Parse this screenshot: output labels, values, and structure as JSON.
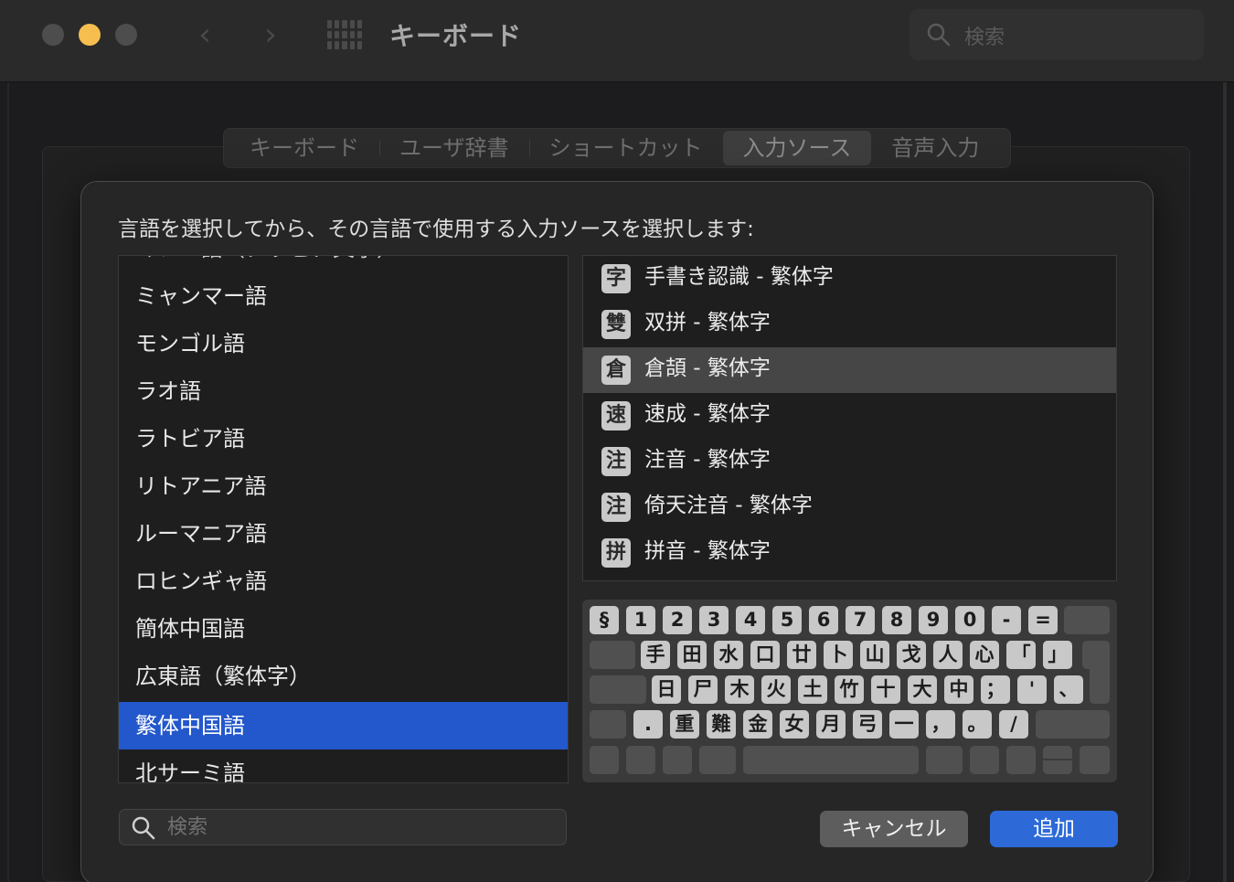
{
  "window": {
    "title": "キーボード",
    "search_placeholder": "検索",
    "nav": {
      "back": "‹",
      "forward": "›"
    }
  },
  "tabs": [
    {
      "label": "キーボード",
      "active": false
    },
    {
      "label": "ユーザ辞書",
      "active": false
    },
    {
      "label": "ショートカット",
      "active": false
    },
    {
      "label": "入力ソース",
      "active": true
    },
    {
      "label": "音声入力",
      "active": false
    }
  ],
  "sheet": {
    "prompt": "言語を選択してから、その言語で使用する入力ソースを選択します:",
    "languages": [
      {
        "label": "ミャンマー語",
        "selected": false
      },
      {
        "label": "モンゴル語",
        "selected": false
      },
      {
        "label": "ラオ語",
        "selected": false
      },
      {
        "label": "ラトビア語",
        "selected": false
      },
      {
        "label": "リトアニア語",
        "selected": false
      },
      {
        "label": "ルーマニア語",
        "selected": false
      },
      {
        "label": "ロヒンギャ語",
        "selected": false
      },
      {
        "label": "簡体中国語",
        "selected": false
      },
      {
        "label": "広東語（繁体字）",
        "selected": false
      },
      {
        "label": "繁体中国語",
        "selected": true
      },
      {
        "label": "北サーミ語",
        "selected": false
      }
    ],
    "sources": [
      {
        "icon": "字",
        "label": "手書き認識 - 繁体字",
        "selected": false
      },
      {
        "icon": "雙",
        "label": "双拼 - 繁体字",
        "selected": false
      },
      {
        "icon": "倉",
        "label": "倉頡 - 繁体字",
        "selected": true
      },
      {
        "icon": "速",
        "label": "速成 - 繁体字",
        "selected": false
      },
      {
        "icon": "注",
        "label": "注音 - 繁体字",
        "selected": false
      },
      {
        "icon": "注",
        "label": "倚天注音 - 繁体字",
        "selected": false
      },
      {
        "icon": "拼",
        "label": "拼音 - 繁体字",
        "selected": false
      }
    ],
    "keyboard_rows": [
      [
        "§",
        "1",
        "2",
        "3",
        "4",
        "5",
        "6",
        "7",
        "8",
        "9",
        "0",
        "-",
        "="
      ],
      [
        "手",
        "田",
        "水",
        "口",
        "廿",
        "卜",
        "山",
        "戈",
        "人",
        "心",
        "「",
        "」"
      ],
      [
        "日",
        "尸",
        "木",
        "火",
        "土",
        "竹",
        "十",
        "大",
        "中",
        "；",
        "'",
        "、"
      ],
      [
        ".",
        "重",
        "難",
        "金",
        "女",
        "月",
        "弓",
        "一",
        "，",
        "。",
        "/"
      ]
    ],
    "search_placeholder": "検索",
    "cancel_label": "キャンセル",
    "add_label": "追加"
  }
}
